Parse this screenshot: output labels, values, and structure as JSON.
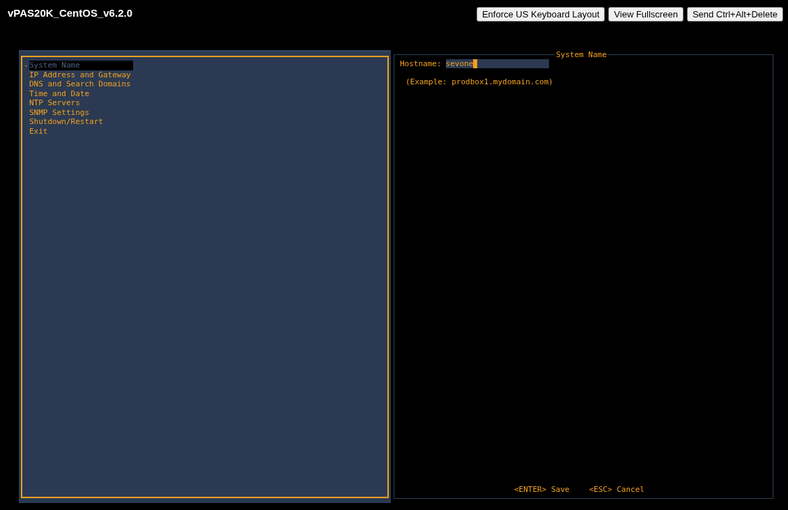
{
  "window": {
    "title": "vPAS20K_CentOS_v6.2.0"
  },
  "toolbar": {
    "buttons": [
      "Enforce US Keyboard Layout",
      "View Fullscreen",
      "Send Ctrl+Alt+Delete"
    ]
  },
  "menu": {
    "marker": "-",
    "items": [
      {
        "label": "System Name",
        "selected": true
      },
      {
        "label": "IP Address and Gateway",
        "selected": false
      },
      {
        "label": "DNS and Search Domains",
        "selected": false
      },
      {
        "label": "Time and Date",
        "selected": false
      },
      {
        "label": "NTP Servers",
        "selected": false
      },
      {
        "label": "SNMP Settings",
        "selected": false
      },
      {
        "label": "Shutdown/Restart",
        "selected": false
      },
      {
        "label": "Exit",
        "selected": false
      }
    ]
  },
  "panel": {
    "title": "System Name",
    "field_label": "Hostname:",
    "field_value": "sevone",
    "hint": "(Example: prodbox1.mydomain.com)",
    "keys": [
      "<ENTER> Save",
      "<ESC> Cancel"
    ]
  }
}
